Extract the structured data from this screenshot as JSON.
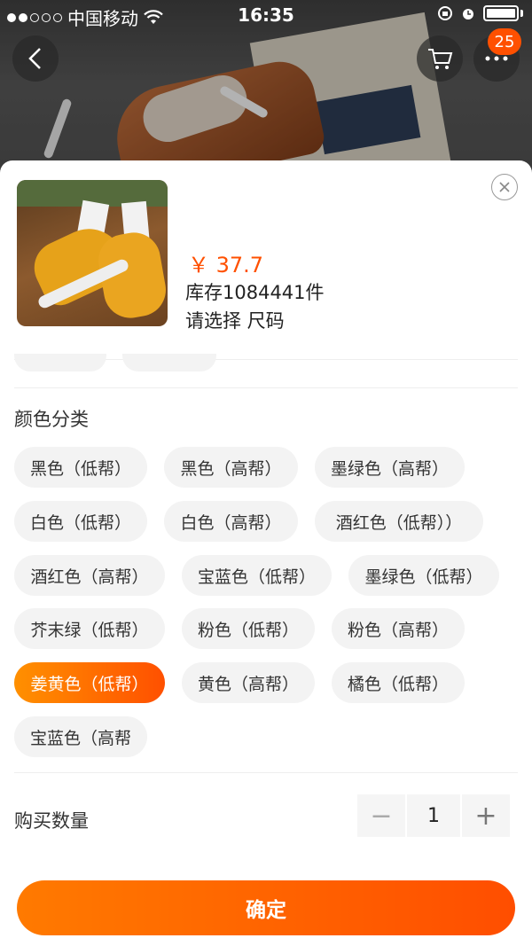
{
  "status_bar": {
    "carrier": "中国移动",
    "time": "16:35"
  },
  "header": {
    "cart_badge": "25",
    "icons": [
      "back-icon",
      "cart-icon",
      "more-icon"
    ]
  },
  "product": {
    "price": "￥ 37.7",
    "stock": "库存1084441件",
    "prompt": "请选择 尺码"
  },
  "color_section": {
    "title": "颜色分类",
    "options": [
      "黑色（低帮）",
      "黑色（高帮）",
      "墨绿色（高帮）",
      "白色（低帮）",
      "白色（高帮）",
      "酒红色（低帮））",
      "酒红色（高帮）",
      "宝蓝色（低帮）",
      "墨绿色（低帮）",
      "芥末绿（低帮）",
      "粉色（低帮）",
      "粉色（高帮）",
      "姜黄色（低帮）",
      "黄色（高帮）",
      "橘色（低帮）",
      "宝蓝色（高帮"
    ],
    "selected": "姜黄色（低帮）"
  },
  "quantity": {
    "label": "购买数量",
    "value": "1",
    "minus": "−",
    "plus": "+"
  },
  "confirm_label": "确定",
  "colors": {
    "accent": "#ff5000",
    "chip_bg": "#f3f3f3"
  }
}
